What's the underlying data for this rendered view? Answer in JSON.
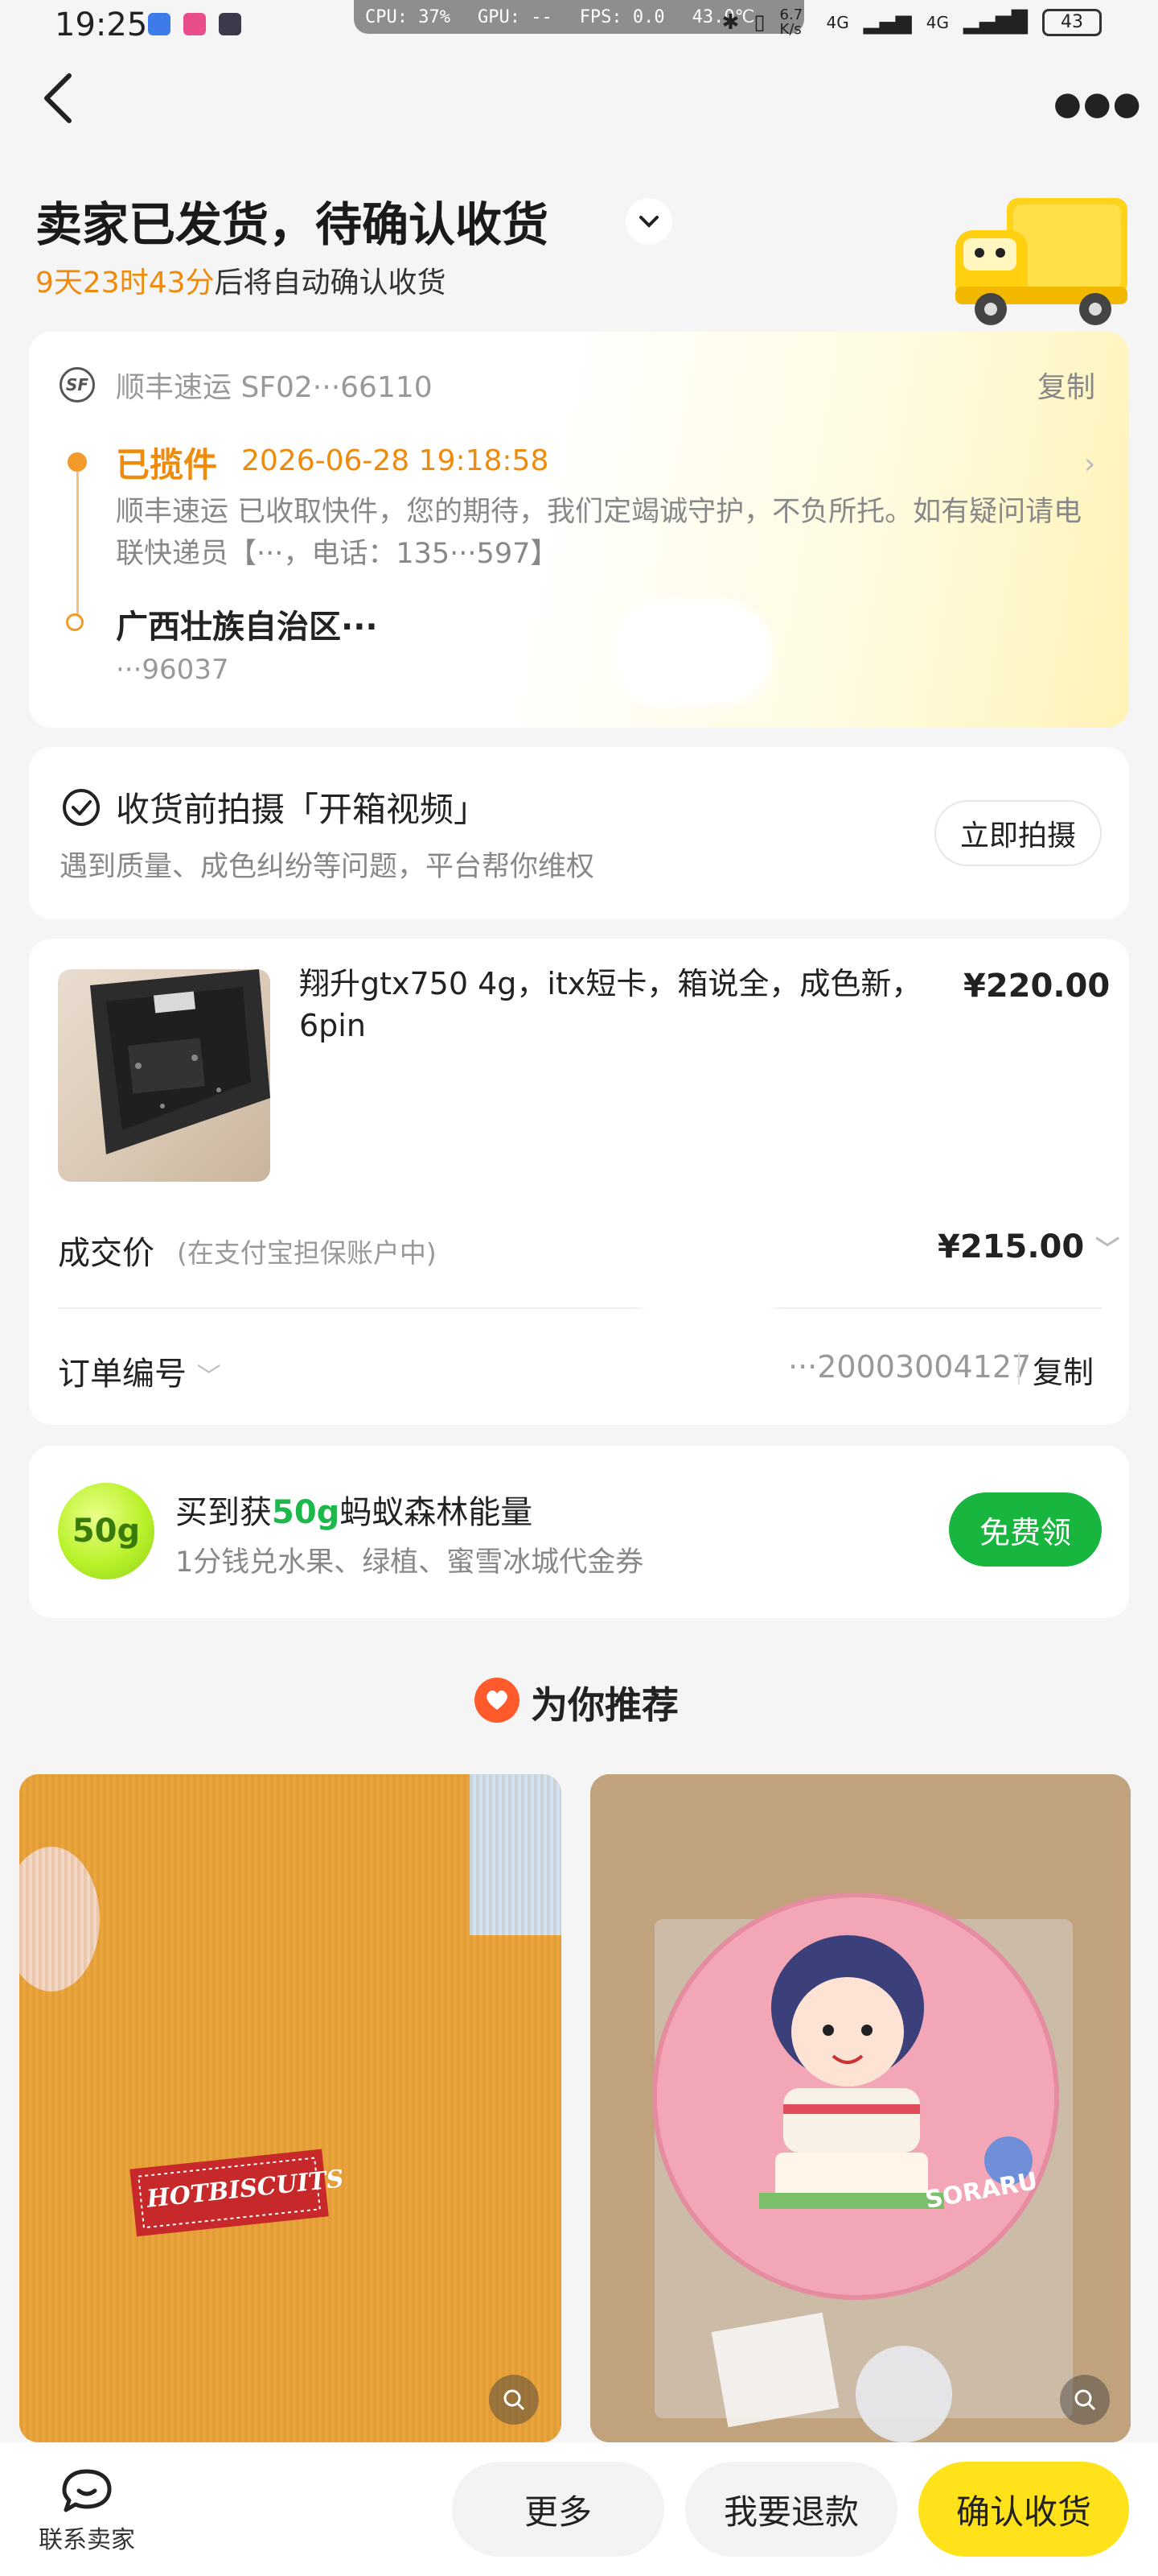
{
  "status_bar": {
    "time": "19:25",
    "cpu": "CPU: 37%",
    "gpu": "GPU: --",
    "fps": "FPS: 0.0",
    "temp": "43.0℃",
    "net_speed": "6.7 K/s",
    "signal1": "4G",
    "signal2": "4G",
    "battery": "43"
  },
  "header": {
    "title": "卖家已发货，待确认收货",
    "countdown": "9天23时43分",
    "countdown_suffix": "后将自动确认收货"
  },
  "logistics": {
    "carrier_line": "顺丰速运 SF02···66110",
    "copy_label": "复制",
    "status": "已揽件",
    "status_time": "2026-06-28 19:18:58",
    "status_desc": "顺丰速运 已收取快件，您的期待，我们定竭诚守护，不负所托。如有疑问请电联快递员【···，电话：135···597】",
    "address_line": "广西壮族自治区···",
    "address_sub": "···96037"
  },
  "unboxing": {
    "title": "收货前拍摄「开箱视频」",
    "subtitle": "遇到质量、成色纠纷等问题，平台帮你维权",
    "button": "立即拍摄"
  },
  "order": {
    "product_name": "翔升gtx750 4g，itx短卡，箱说全，成色新，6pin",
    "product_price": "¥220.00",
    "deal_label": "成交价",
    "deal_note": "(在支付宝担保账户中)",
    "deal_price": "¥215.00",
    "order_no_label": "订单编号",
    "order_no": "···20003004127",
    "copy_label": "复制"
  },
  "energy": {
    "badge": "50g",
    "title_prefix": "买到获",
    "title_highlight": "50g",
    "title_suffix": "蚂蚁森林能量",
    "subtitle": "1分钱兑水果、绿植、蜜雪冰城代金券",
    "button": "免费领"
  },
  "recommend": {
    "title": "为你推荐",
    "items": [
      {
        "label_text": "HOTBISCUITS"
      },
      {
        "label_text": "SORARU"
      }
    ]
  },
  "bottom_bar": {
    "contact_label": "联系卖家",
    "more": "更多",
    "refund": "我要退款",
    "confirm": "确认收货"
  },
  "colors": {
    "accent_orange": "#ef8a0b",
    "green": "#19b63f",
    "yellow": "#ffe21a"
  }
}
